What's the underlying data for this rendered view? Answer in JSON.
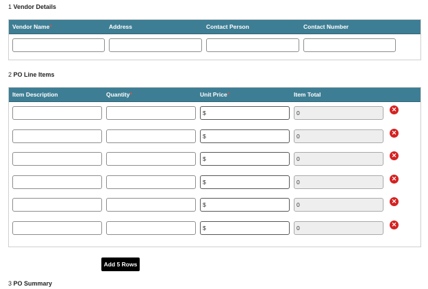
{
  "vendor": {
    "section_num": "1",
    "section_title": "Vendor Details",
    "columns": [
      {
        "label": "Vendor Name",
        "required": true
      },
      {
        "label": "Address",
        "required": false
      },
      {
        "label": "Contact Person",
        "required": false
      },
      {
        "label": "Contact Number",
        "required": false
      }
    ],
    "values": [
      "",
      "",
      "",
      ""
    ]
  },
  "line_items": {
    "section_num": "2",
    "section_title": "PO Line Items",
    "columns": [
      {
        "label": "Item Description",
        "required": false
      },
      {
        "label": "Quantity",
        "required": true
      },
      {
        "label": "Unit Price",
        "required": true
      },
      {
        "label": "Item Total",
        "required": false
      }
    ],
    "rows": [
      {
        "description": "",
        "quantity": "",
        "unit_price": "$",
        "item_total": "0"
      },
      {
        "description": "",
        "quantity": "",
        "unit_price": "$",
        "item_total": "0"
      },
      {
        "description": "",
        "quantity": "",
        "unit_price": "$",
        "item_total": "0"
      },
      {
        "description": "",
        "quantity": "",
        "unit_price": "$",
        "item_total": "0"
      },
      {
        "description": "",
        "quantity": "",
        "unit_price": "$",
        "item_total": "0"
      },
      {
        "description": "",
        "quantity": "",
        "unit_price": "$",
        "item_total": "0"
      }
    ],
    "delete_icon": "close-circle-icon",
    "delete_glyph": "✕"
  },
  "add_rows_label": "Add 5 Rows",
  "summary": {
    "section_num": "3",
    "section_title": "PO Summary"
  },
  "required_mark": "*",
  "colors": {
    "header_bg": "#3e7e94",
    "delete_red": "#d42222",
    "required_red": "#d9534f",
    "button_bg": "#000000"
  }
}
